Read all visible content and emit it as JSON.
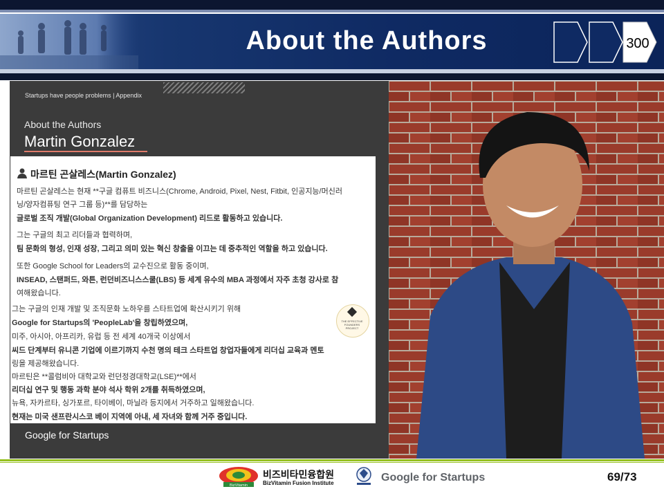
{
  "header": {
    "title": "About the Authors",
    "slide_badge": "300"
  },
  "slide": {
    "breadcrumb": "Startups have people problems  |  Appendix",
    "about_label": "About the Authors",
    "author_name": "Martin Gonzalez",
    "footer_brand": "Google for Startups"
  },
  "card": {
    "title": "마르틴 곤살레스(Martin Gonzalez)",
    "lines": [
      "마르틴 곤살레스는 현재 **구글 컴퓨트 비즈니스(Chrome, Android, Pixel, Nest, Fitbit, 인공지능/머신러",
      "닝/양자컴퓨팅 연구 그룹 등)**를 담당하는",
      "글로벌 조직 개발(Global Organization Development) 리드로 활동하고 있습니다.",
      "그는 구글의 최고 리더들과 협력하며,",
      "팀 문화의 형성, 인재 성장, 그리고 의미 있는 혁신 창출을 이끄는 데 중추적인 역할을 하고 있습니다.",
      "또한 Google School for Leaders의 교수진으로 활동 중이며,",
      "INSEAD, 스탠퍼드, 와튼, 런던비즈니스스쿨(LBS) 등 세계 유수의 MBA 과정에서 자주 초청 강사로 참",
      "여해왔습니다.",
      "그는 구글의 인재 개발 및 조직문화 노하우를 스타트업에 확산시키기 위해",
      "Google for Startups의 'PeopleLab'을 창립하였으며,",
      "미주, 아시아, 아프리카, 유럽 등 전 세계 40개국 이상에서",
      "씨드 단계부터 유니콘 기업에 이르기까지 수천 명의 테크 스타트업 창업자들에게 리더십 교육과 멘토",
      "링을 제공해왔습니다.",
      "마르틴은 **콜럼비아 대학교와 런던정경대학교(LSE)**에서",
      "리더십 연구 및 행동 과학 분야 석사 학위 2개를 취득하였으며,",
      "뉴욕, 자카르타, 싱가포르, 타이베이, 마닐라 등지에서 거주하고 일해왔습니다.",
      "현재는 미국 샌프란시스코 베이 지역에 아내, 세 자녀와 함께 거주 중입니다."
    ],
    "logo_caption": "THE EFFECTIVE FOUNDERS PROJECT"
  },
  "footer": {
    "org_korean": "비즈비타민융합원",
    "org_english": "BizVitamin Fusion Institute",
    "logo_small_text": "BizVitamin",
    "partner": "Google for Startups",
    "page": "69/73"
  },
  "colors": {
    "header_blue": "#0f2a63",
    "dark_strip": "#0c1630",
    "slide_bg": "#3b3b3b",
    "footer_green": "#95c11f",
    "underline_accent": "#e07b6a"
  },
  "icons": [
    "people-photo",
    "chevron-icon",
    "person-icon",
    "founders-project-logo",
    "bizvitamin-logo",
    "emblem-icon"
  ]
}
